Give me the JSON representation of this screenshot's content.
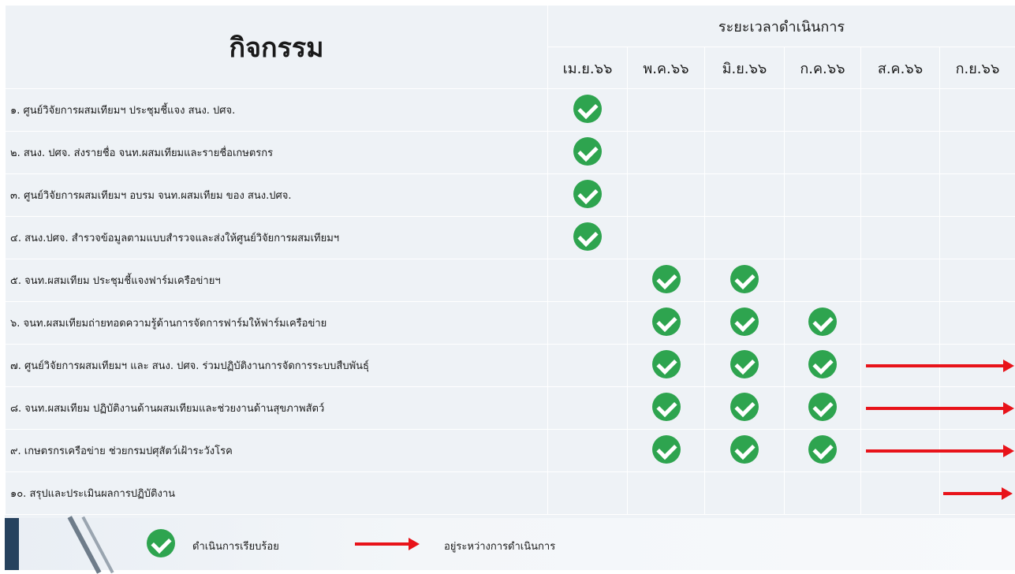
{
  "header": {
    "activity_title": "กิจกรรม",
    "period_title": "ระยะเวลาดำเนินการ",
    "months": [
      "เม.ย.๖๖",
      "พ.ค.๖๖",
      "มิ.ย.๖๖",
      "ก.ค.๖๖",
      "ส.ค.๖๖",
      "ก.ย.๖๖"
    ]
  },
  "rows": [
    {
      "label": "๑. ศูนย์วิจัยการผสมเทียมฯ ประชุมชี้แจง สนง. ปศจ.",
      "checks": [
        0
      ],
      "arrow": null
    },
    {
      "label": "๒. สนง. ปศจ. ส่งรายชื่อ จนท.ผสมเทียมและรายชื่อเกษตรกร",
      "checks": [
        0
      ],
      "arrow": null
    },
    {
      "label": "๓. ศูนย์วิจัยการผสมเทียมฯ อบรม จนท.ผสมเทียม ของ สนง.ปศจ.",
      "checks": [
        0
      ],
      "arrow": null
    },
    {
      "label": "๔. สนง.ปศจ. สำรวจข้อมูลตามแบบสำรวจและส่งให้ศูนย์วิจัยการผสมเทียมฯ",
      "checks": [
        0
      ],
      "arrow": null
    },
    {
      "label": "๕. จนท.ผสมเทียม ประชุมชี้แจงฟาร์มเครือข่ายฯ",
      "checks": [
        1,
        2
      ],
      "arrow": null
    },
    {
      "label": "๖. จนท.ผสมเทียมถ่ายทอดความรู้ด้านการจัดการฟาร์มให้ฟาร์มเครือข่าย",
      "checks": [
        1,
        2,
        3
      ],
      "arrow": null
    },
    {
      "label": "๗. ศูนย์วิจัยการผสมเทียมฯ และ สนง. ปศจ. ร่วมปฏิบัติงานการจัดการระบบสืบพันธุ์",
      "checks": [
        1,
        2,
        3
      ],
      "arrow": "ส.ค.-ก.ย."
    },
    {
      "label": "๘. จนท.ผสมเทียม ปฏิบัติงานด้านผสมเทียมและช่วยงานด้านสุขภาพสัตว์",
      "checks": [
        1,
        2,
        3
      ],
      "arrow": "ส.ค.-ก.ย."
    },
    {
      "label": "๙. เกษตรกรเครือข่าย ช่วยกรมปศุสัตว์เฝ้าระวังโรค",
      "checks": [
        1,
        2,
        3
      ],
      "arrow": "ส.ค.-ก.ย."
    },
    {
      "label": "๑๐. สรุปและประเมินผลการปฏิบัติงาน",
      "checks": [],
      "arrow": "ก.ย."
    }
  ],
  "legend": {
    "done_label": "ดำเนินการเรียบร้อย",
    "in_progress_label": "อยู่ระหว่างการดำเนินการ"
  },
  "colors": {
    "check": "#2ea44f",
    "arrow": "#e8131a",
    "background": "#eef2f6"
  }
}
